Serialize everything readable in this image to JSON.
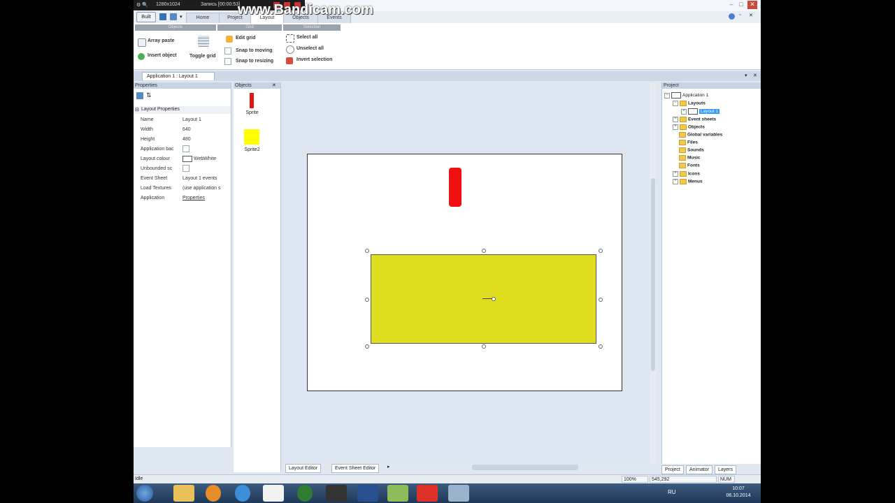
{
  "recorder": {
    "resolution": "1280x1024",
    "recording": "Запись [00:00:53]"
  },
  "watermark": "www.Bandicam.com",
  "ribbon": {
    "built_button": "Built",
    "tabs": [
      "Home",
      "Project",
      "Layout",
      "Objects",
      "Events"
    ],
    "active_tab": "Layout",
    "groups": [
      "Objects",
      "Grid",
      "Selection"
    ],
    "commands": {
      "array_paste": "Array paste",
      "insert_object": "Insert object",
      "toggle_grid": "Toggle grid",
      "edit_grid": "Edit grid",
      "snap_moving": "Snap to moving",
      "snap_resizing": "Snap to resizing",
      "select_all": "Select all",
      "unselect_all": "Unselect all",
      "invert_selection": "Invert selection"
    }
  },
  "document_tab": "Application 1 : Layout 1",
  "properties": {
    "title": "Properties",
    "section": "Layout Properties",
    "rows": [
      {
        "name": "Name",
        "value": "Layout 1"
      },
      {
        "name": "Width",
        "value": "640"
      },
      {
        "name": "Height",
        "value": "480"
      },
      {
        "name": "Application bac",
        "value": ""
      },
      {
        "name": "Layout colour",
        "value": "WebWhite"
      },
      {
        "name": "Unbounded sc",
        "value": ""
      },
      {
        "name": "Event Sheet",
        "value": "Layout 1 events"
      },
      {
        "name": "Load Textures",
        "value": "(use application s"
      },
      {
        "name": "Application",
        "value": "Properties"
      }
    ]
  },
  "objects_panel": {
    "title": "Objects",
    "items": [
      {
        "label": "Sprite",
        "color": "#e61414"
      },
      {
        "label": "Sprite2",
        "color": "#ffff00"
      }
    ]
  },
  "editor_tabs": [
    "Layout Editor",
    "Event Sheet Editor"
  ],
  "project": {
    "title": "Project",
    "root": "Application 1",
    "layouts_folder": "Layouts",
    "selected_layout": "Layout 1",
    "folders": [
      "Event sheets",
      "Objects",
      "Global variables",
      "Files",
      "Sounds",
      "Music",
      "Fonts",
      "Icons",
      "Menus"
    ],
    "tabs": [
      "Project",
      "Animator",
      "Layers"
    ]
  },
  "status": {
    "text": "Idle",
    "zoom": "100%",
    "coords": "545,292",
    "num": "NUM"
  },
  "taskbar": {
    "lang": "RU",
    "time": "10:07",
    "date": "06.10.2014"
  },
  "colors": {
    "sprite_red": "#f01010",
    "sprite_yellow": "#e0dc1f"
  }
}
